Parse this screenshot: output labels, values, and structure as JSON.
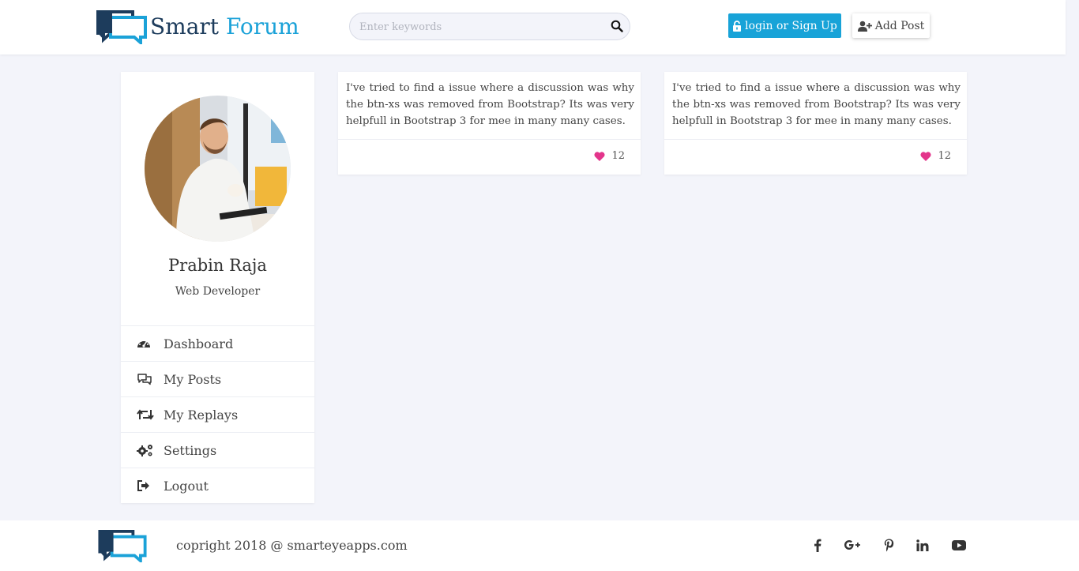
{
  "header": {
    "logo_word1": "Smart",
    "logo_word2": "Forum",
    "search_placeholder": "Enter keywords",
    "login_label": "login or Sign Up",
    "add_post_label": "Add Post"
  },
  "profile": {
    "name": "Prabin Raja",
    "role": "Web Developer"
  },
  "menu": [
    {
      "label": "Dashboard",
      "icon": "dashboard-icon"
    },
    {
      "label": "My Posts",
      "icon": "comments-icon"
    },
    {
      "label": "My Replays",
      "icon": "retweet-icon"
    },
    {
      "label": "Settings",
      "icon": "gears-icon"
    },
    {
      "label": "Logout",
      "icon": "sign-out-icon"
    }
  ],
  "posts": [
    {
      "text": "I've tried to find a issue where a discussion was why the btn-xs was removed from Bootstrap? Its was very helpfull in Bootstrap 3 for mee in many many cases.",
      "likes": "12"
    },
    {
      "text": "I've tried to find a issue where a discussion was why the btn-xs was removed from Bootstrap? Its was very helpfull in Bootstrap 3 for mee in many many cases.",
      "likes": "12"
    }
  ],
  "footer": {
    "copyright": "copright 2018 @ smarteyeapps.com",
    "social": [
      "facebook-icon",
      "google-plus-icon",
      "pinterest-icon",
      "linkedin-icon",
      "youtube-icon"
    ]
  },
  "colors": {
    "accent": "#18a3d8",
    "brand_dark": "#1d3c5c",
    "heart": "#e3358b",
    "background": "#f3f4fa"
  }
}
